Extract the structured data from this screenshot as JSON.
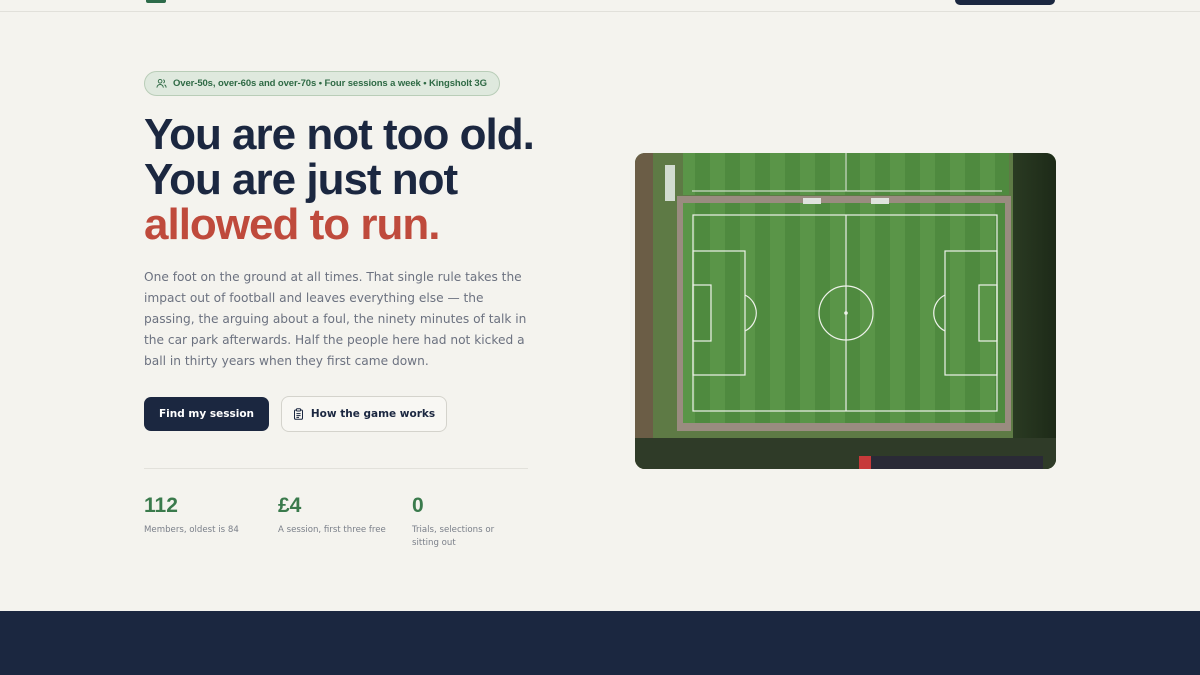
{
  "badge": {
    "icon": "people-icon",
    "text": "Over-50s, over-60s and over-70s • Four sessions a week • Kingsholt 3G"
  },
  "hero": {
    "line1": "You are not too old.",
    "line2": "You are just not",
    "line3": "allowed to run.",
    "accent_color": "#bf4a3c",
    "description": "One foot on the ground at all times. That single rule takes the impact out of football and leaves everything else — the passing, the arguing about a foul, the ninety minutes of talk in the car park afterwards. Half the people here had not kicked a ball in thirty years when they first came down."
  },
  "actions": {
    "primary_label": "Find my session",
    "secondary_label": "How the game works",
    "secondary_icon": "clipboard-icon"
  },
  "stats": [
    {
      "value": "112",
      "label": "Members, oldest is 84"
    },
    {
      "value": "£4",
      "label": "A session, first three free"
    },
    {
      "value": "0",
      "label": "Trials, selections or sitting out"
    }
  ],
  "colors": {
    "navy": "#1b2740",
    "green": "#3a7a4c",
    "background": "#f4f3ee"
  }
}
